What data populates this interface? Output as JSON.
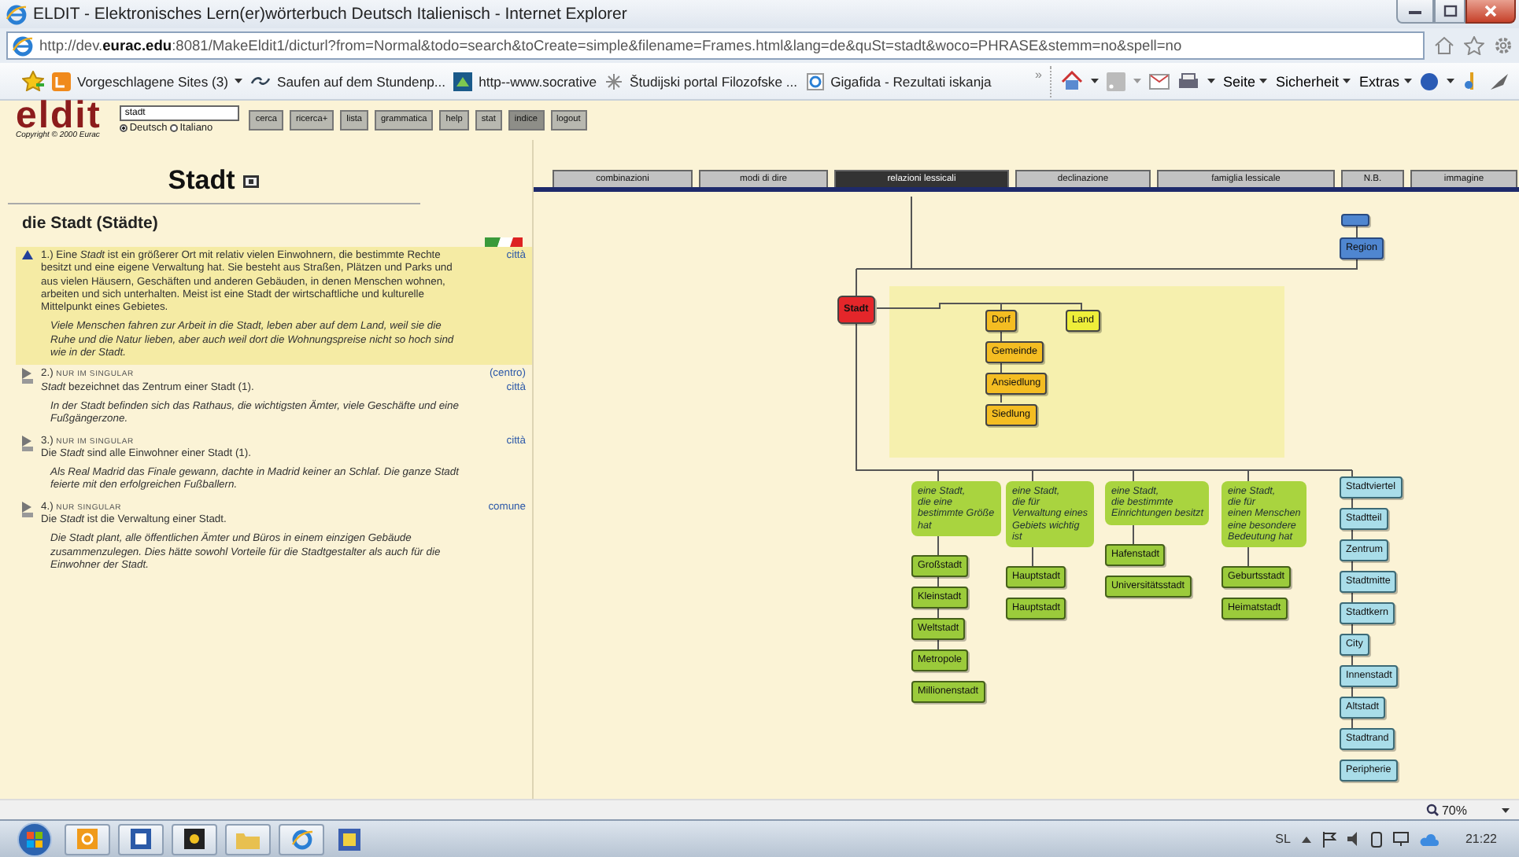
{
  "window": {
    "title": "ELDIT - Elektronisches Lern(er)wörterbuch Deutsch Italienisch - Internet Explorer"
  },
  "address_bar": {
    "url": "http://dev.**eurac.edu**:8081/MakeEldit1/dicturl?from=Normal&todo=search&toCreate=simple&filename=Frames.html&lang=de&quSt=stadt&woco=PHRASE&stemm=no&spell=no"
  },
  "favorites": [
    {
      "label": "Vorgeschlagene Sites (3)",
      "kind": "dropdown"
    },
    {
      "label": "Saufen auf dem Stundenp...",
      "kind": "link"
    },
    {
      "label": "http--www.socrative",
      "kind": "link"
    },
    {
      "label": "Študijski portal Filozofske ...",
      "kind": "link"
    },
    {
      "label": "Gigafida - Rezultati iskanja",
      "kind": "link"
    }
  ],
  "favorites_overflow": "»",
  "command_bar": [
    "Seite",
    "Sicherheit",
    "Extras"
  ],
  "eldit": {
    "logo": "eldit",
    "copyright": "Copyright © 2000 Eurac",
    "search_value": "stadt",
    "languages": [
      {
        "label": "Deutsch",
        "selected": true
      },
      {
        "label": "Italiano",
        "selected": false
      }
    ],
    "buttons": [
      {
        "label": "cerca",
        "selected": false
      },
      {
        "label": "ricerca+",
        "selected": false
      },
      {
        "label": "lista",
        "selected": false
      },
      {
        "label": "grammatica",
        "selected": false
      },
      {
        "label": "help",
        "selected": false
      },
      {
        "label": "stat",
        "selected": false
      },
      {
        "label": "indice",
        "selected": true
      },
      {
        "label": "logout",
        "selected": false
      }
    ]
  },
  "entry": {
    "headword": "Stadt",
    "lemma": "die Stadt (Städte)",
    "senses": [
      {
        "number": "1.)",
        "expanded": true,
        "definition": "Eine *Stadt* ist ein größerer Ort mit relativ vielen Einwohnern, die bestimmte Rechte besitzt und eine eigene Verwaltung hat. Sie besteht aus Straßen, Plätzen und Parks und aus vielen Häusern, Geschäften und anderen Gebäuden, in denen Menschen wohnen, arbeiten und sich unterhalten. Meist ist eine Stadt der wirtschaftliche und kulturelle Mittelpunkt eines Gebietes.",
        "example": "Viele Menschen fahren zur Arbeit in die Stadt, leben aber auf dem Land, weil sie die Ruhe und die Natur lieben, aber auch weil dort die Wohnungspreise nicht so hoch sind wie in der Stadt.",
        "translations": [
          "città"
        ]
      },
      {
        "number": "2.)",
        "usage": "NUR IM SINGULAR",
        "expanded": false,
        "definition": "*Stadt* bezeichnet das Zentrum einer Stadt (1).",
        "example": "In der Stadt befinden sich das Rathaus, die wichtigsten Ämter, viele Geschäfte und eine Fußgängerzone.",
        "translations": [
          "(centro)",
          "città"
        ]
      },
      {
        "number": "3.)",
        "usage": "NUR IM SINGULAR",
        "expanded": false,
        "definition": "Die *Stadt* sind alle Einwohner einer Stadt (1).",
        "example": "Als Real Madrid das Finale gewann, dachte in Madrid keiner an Schlaf. Die ganze Stadt feierte mit den erfolgreichen Fußballern.",
        "translations": [
          "città"
        ]
      },
      {
        "number": "4.)",
        "usage": "NUR SINGULAR",
        "expanded": false,
        "definition": "Die *Stadt* ist die Verwaltung einer Stadt.",
        "example": "Die Stadt plant, alle öffentlichen Ämter und Büros in einem einzigen Gebäude zusammenzulegen. Dies hätte sowohl Vorteile für die Stadtgestalter als auch für die Einwohner der Stadt.",
        "translations": [
          "comune"
        ]
      }
    ]
  },
  "tabs": [
    {
      "label": "combinazioni",
      "selected": false
    },
    {
      "label": "modi di dire",
      "selected": false
    },
    {
      "label": "relazioni lessicali",
      "selected": true
    },
    {
      "label": "declinazione",
      "selected": false
    },
    {
      "label": "famiglia lessicale",
      "selected": false
    },
    {
      "label": "N.B.",
      "selected": false
    },
    {
      "label": "immagine",
      "selected": false
    }
  ],
  "relations": {
    "upper": [
      "Region"
    ],
    "root": "Stadt",
    "near": [
      {
        "text": "Dorf",
        "color": "#f4bd22",
        "children": [
          "Gemeinde",
          "Ansiedlung",
          "Siedlung"
        ]
      },
      {
        "text": "Land",
        "color": "#eeee3a"
      }
    ],
    "groups": [
      {
        "definition": "eine Stadt,\ndie eine\nbestimmte Größe\nhat",
        "items": [
          "Großstadt",
          "Kleinstadt",
          "Weltstadt",
          "Metropole",
          "Millionenstadt"
        ]
      },
      {
        "definition": "eine Stadt,\ndie für\nVerwaltung eines\nGebiets wichtig\nist",
        "items": [
          "Hauptstadt",
          "Hauptstadt"
        ]
      },
      {
        "definition": "eine Stadt,\ndie bestimmte\nEinrichtungen besitzt",
        "items": [
          "Hafenstadt",
          "Universitätsstadt"
        ]
      },
      {
        "definition": "eine Stadt,\ndie für\neinen Menschen\neine besondere\nBedeutung hat",
        "items": [
          "Geburtsstadt",
          "Heimatstadt"
        ]
      }
    ],
    "parts": [
      "Stadtviertel",
      "Stadtteil",
      "Zentrum",
      "Stadtmitte",
      "Stadtkern",
      "City",
      "Innenstadt",
      "Altstadt",
      "Stadtrand",
      "Peripherie"
    ]
  },
  "status_bar": {
    "zoom": "70%"
  },
  "taskbar": {
    "language": "SL",
    "clock": "21:22"
  }
}
